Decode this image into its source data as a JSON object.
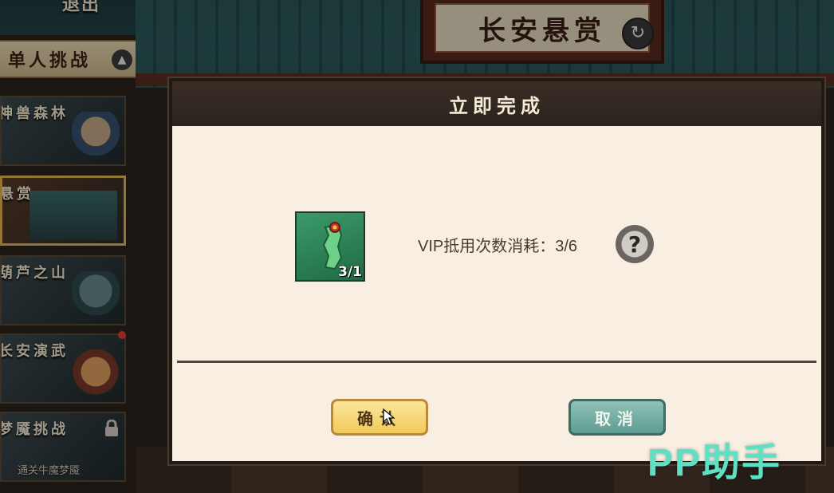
{
  "top": {
    "back_label": "退出",
    "banner_title": "长安悬赏"
  },
  "sidebar": {
    "header_label": "单人挑战",
    "items": [
      {
        "label": "神兽森林"
      },
      {
        "label": "悬赏"
      },
      {
        "label": "葫芦之山"
      },
      {
        "label": "长安演武"
      },
      {
        "label": "梦魇挑战",
        "sub": "通关牛魔梦魇"
      }
    ]
  },
  "dialog": {
    "title": "立即完成",
    "item_count": "3/1",
    "vip_text": "VIP抵用次数消耗：3/6",
    "help_glyph": "?",
    "confirm_label": "确认",
    "cancel_label": "取消"
  },
  "watermark": "PP助手",
  "colors": {
    "confirm": "#f1c95a",
    "cancel": "#5e9c91",
    "watermark": "#5fe0c2"
  }
}
